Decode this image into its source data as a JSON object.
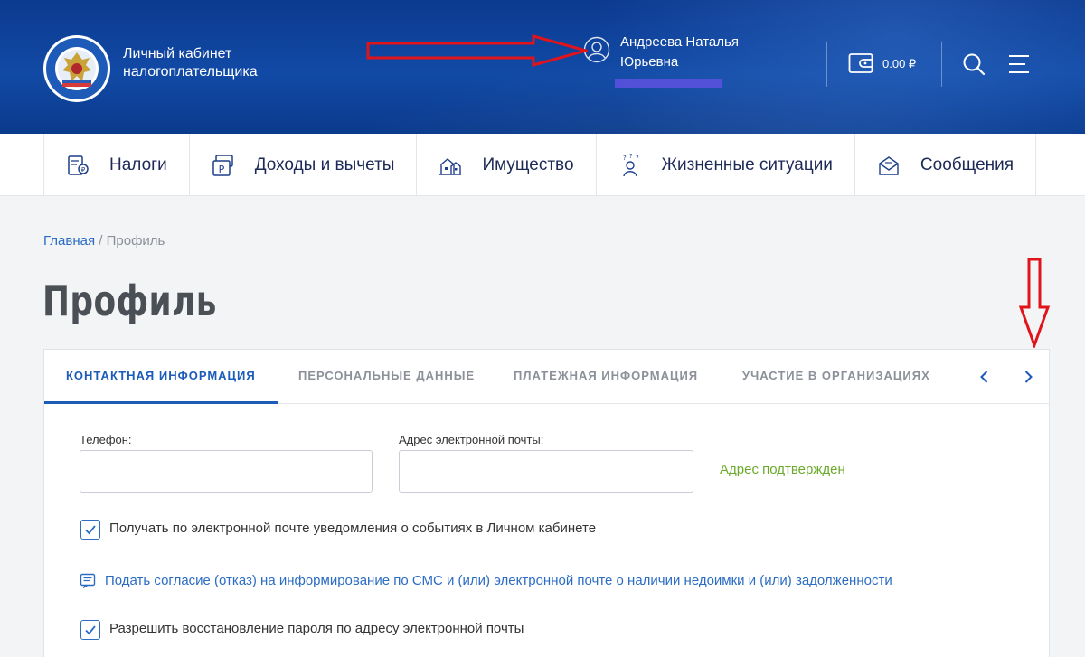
{
  "header": {
    "brand_line1": "Личный кабинет",
    "brand_line2": "налогоплательщика",
    "user_first": "Андреева Наталья",
    "user_second": "Юрьевна",
    "balance": "0.00 ₽",
    "icons": [
      "logo-emblem",
      "user-icon",
      "wallet-icon",
      "search-icon",
      "menu-icon"
    ]
  },
  "nav": {
    "items": [
      {
        "label": "Налоги",
        "icon": "taxes-icon"
      },
      {
        "label": "Доходы и вычеты",
        "icon": "income-icon"
      },
      {
        "label": "Имущество",
        "icon": "property-icon"
      },
      {
        "label": "Жизненные ситуации",
        "icon": "life-situations-icon"
      },
      {
        "label": "Сообщения",
        "icon": "messages-icon"
      }
    ]
  },
  "breadcrumb": {
    "home": "Главная",
    "separator": " / ",
    "current": "Профиль"
  },
  "page": {
    "title": "Профиль"
  },
  "tabs": [
    {
      "label": "КОНТАКТНАЯ ИНФОРМАЦИЯ",
      "active": true
    },
    {
      "label": "ПЕРСОНАЛЬНЫЕ ДАННЫЕ",
      "active": false
    },
    {
      "label": "ПЛАТЕЖНАЯ ИНФОРМАЦИЯ",
      "active": false
    },
    {
      "label": "УЧАСТИЕ В ОРГАНИЗАЦИЯХ",
      "active": false
    }
  ],
  "form": {
    "phone_label": "Телефон:",
    "phone_value": "",
    "email_label": "Адрес электронной почты:",
    "email_value": "",
    "email_status": "Адрес подтвержден",
    "notify_label": "Получать по электронной почте уведомления о событиях в Личном кабинете",
    "notify_checked": true,
    "consent_link": "Подать согласие (отказ) на информирование по СМС и (или) электронной почте о наличии недоимки и (или) задолженности",
    "restore_label": "Разрешить восстановление пароля по адресу электронной почты",
    "restore_checked": true
  },
  "colors": {
    "header_bg": "#114aa6",
    "accent": "#1d5bb8",
    "link": "#2b6cc4",
    "success": "#6aaa2b",
    "annotation": "#e0141a"
  }
}
